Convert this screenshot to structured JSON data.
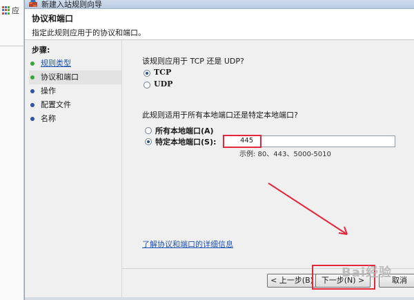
{
  "background_app": {
    "fragment": "应"
  },
  "window": {
    "title": "新建入站规则向导"
  },
  "header": {
    "title": "协议和端口",
    "subtitle": "指定此规则应用于的协议和端口。"
  },
  "steps": {
    "label": "步骤:",
    "items": [
      {
        "label": "规则类型",
        "state": "done"
      },
      {
        "label": "协议和端口",
        "state": "current"
      },
      {
        "label": "操作",
        "state": "pending"
      },
      {
        "label": "配置文件",
        "state": "pending"
      },
      {
        "label": "名称",
        "state": "pending"
      }
    ]
  },
  "protocol": {
    "question": "该规则应用于 TCP 还是 UDP?",
    "options": [
      {
        "label": "TCP",
        "selected": true
      },
      {
        "label": "UDP",
        "selected": false
      }
    ]
  },
  "ports": {
    "question": "此规则适用于所有本地端口还是特定本地端口?",
    "all_label": "所有本地端口(A)",
    "specific_label": "特定本地端口(S):",
    "specific_selected": true,
    "value": "445",
    "example": "示例: 80、443、5000-5010"
  },
  "learn_more": "了解协议和端口的详细信息",
  "buttons": {
    "back": "< 上一步(B)",
    "next": "下一步(N) >",
    "cancel": "取消"
  },
  "watermark": "Bai经验",
  "colors": {
    "highlight": "#e3263a",
    "link": "#1e52b7",
    "radio_dot": "#2c4f8a"
  }
}
